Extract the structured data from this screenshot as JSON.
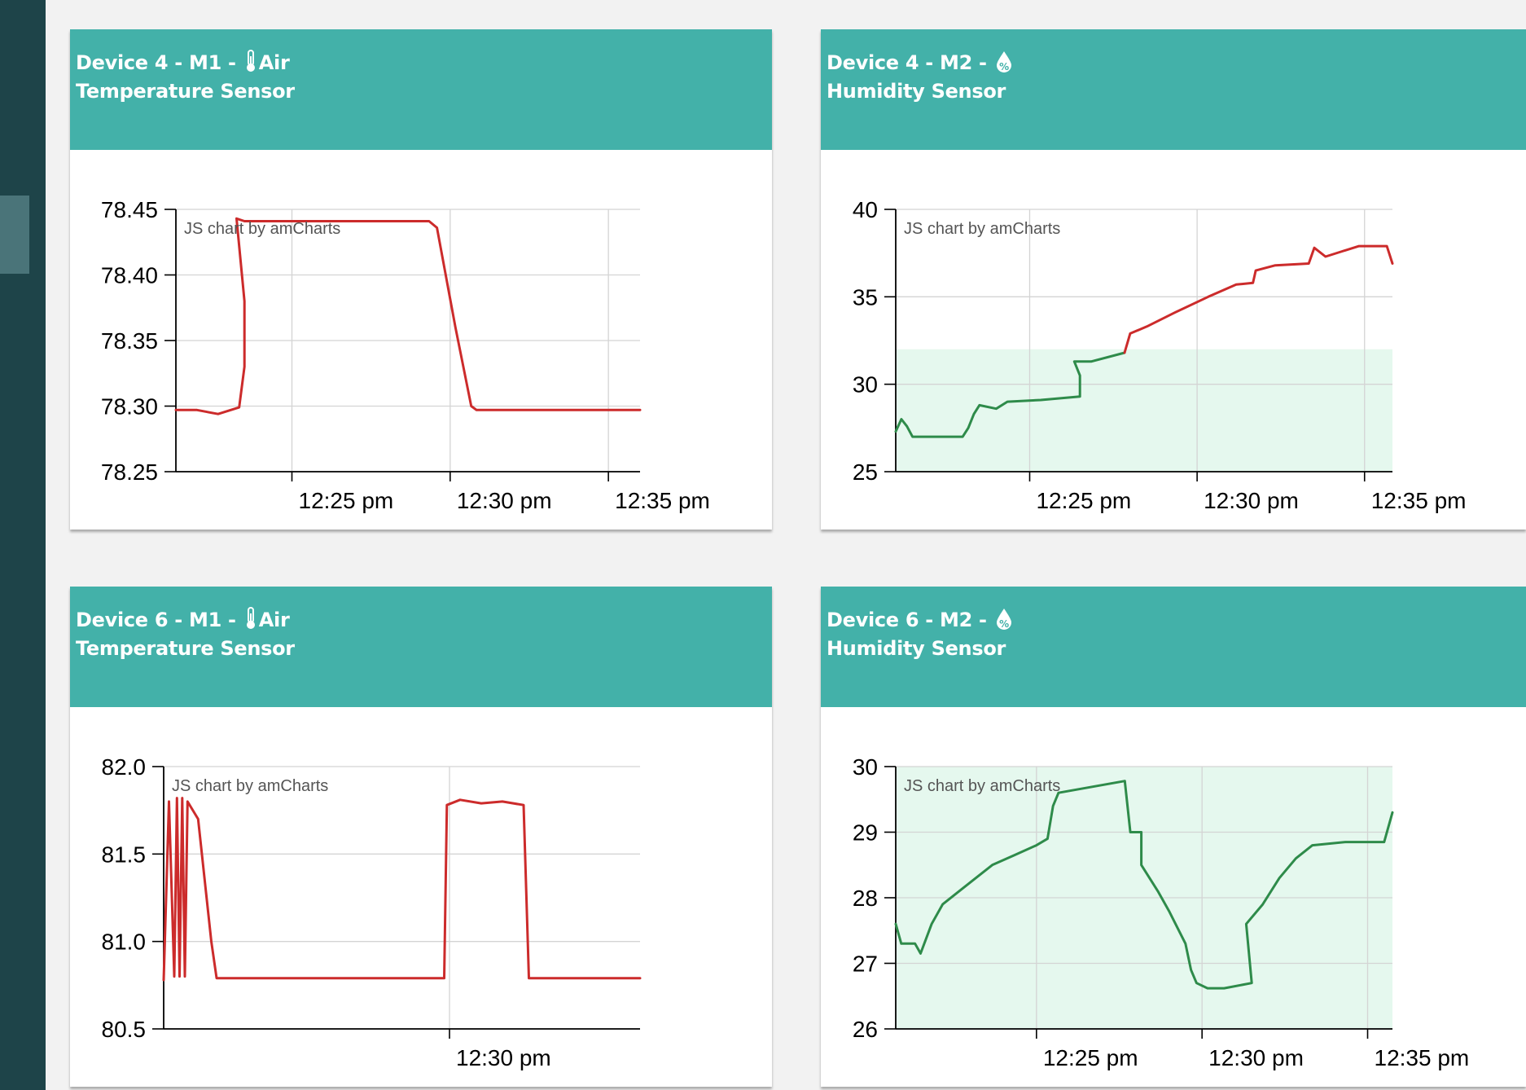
{
  "cards": [
    {
      "title_prefix": "Device 4 - M1 - ",
      "icon": "thermometer-icon",
      "title_suffix": "Air Temperature Sensor",
      "credit": "JS chart by amCharts"
    },
    {
      "title_prefix": "Device 4 - M2 - ",
      "icon": "humidity-drop-icon",
      "title_suffix": "Humidity Sensor",
      "credit": "JS chart by amCharts"
    },
    {
      "title_prefix": "Device 6 - M1 - ",
      "icon": "thermometer-icon",
      "title_suffix": "Air Temperature Sensor",
      "credit": "JS chart by amCharts"
    },
    {
      "title_prefix": "Device 6 - M2 - ",
      "icon": "humidity-drop-icon",
      "title_suffix": "Humidity Sensor",
      "credit": "JS chart by amCharts"
    }
  ],
  "colors": {
    "header": "#43b1a9",
    "sidebar": "#1e4449",
    "line_red": "#cc2b2b",
    "line_green": "#2e8b4a",
    "band_fill": "#e5f8ee"
  },
  "chart_data": [
    {
      "type": "line",
      "xlim": [
        "12:20:40",
        "12:35:20"
      ],
      "ylim": [
        78.25,
        78.45
      ],
      "y_ticks": [
        "78.45",
        "78.40",
        "78.35",
        "78.30",
        "78.25"
      ],
      "x_ticks": [
        {
          "t": "12:24:20",
          "label": "12:25 pm"
        },
        {
          "t": "12:29:20",
          "label": "12:30 pm"
        },
        {
          "t": "12:34:20",
          "label": "12:35 pm"
        }
      ],
      "series": [
        {
          "color": "#cc2b2b",
          "points": [
            [
              "12:20:40",
              78.297
            ],
            [
              "12:21:20",
              78.297
            ],
            [
              "12:22:00",
              78.294
            ],
            [
              "12:22:40",
              78.299
            ],
            [
              "12:22:50",
              78.33
            ],
            [
              "12:22:50",
              78.38
            ],
            [
              "12:22:35",
              78.443
            ],
            [
              "12:22:50",
              78.441
            ],
            [
              "12:28:40",
              78.441
            ],
            [
              "12:28:55",
              78.436
            ],
            [
              "12:29:30",
              78.36
            ],
            [
              "12:30:00",
              78.3
            ],
            [
              "12:30:10",
              78.297
            ],
            [
              "12:35:20",
              78.297
            ]
          ]
        }
      ]
    },
    {
      "type": "line",
      "xlim": [
        "12:20:40",
        "12:35:30"
      ],
      "ylim": [
        25,
        40
      ],
      "y_ticks": [
        "40",
        "35",
        "30",
        "25"
      ],
      "x_ticks": [
        {
          "t": "12:24:40",
          "label": "12:25 pm"
        },
        {
          "t": "12:29:40",
          "label": "12:30 pm"
        },
        {
          "t": "12:34:40",
          "label": "12:35 pm"
        }
      ],
      "band": {
        "from": 25,
        "to": 32
      },
      "series": [
        {
          "color": "#2e8b4a",
          "points": [
            [
              "12:20:40",
              27.3
            ],
            [
              "12:20:50",
              28.0
            ],
            [
              "12:21:00",
              27.6
            ],
            [
              "12:21:10",
              27.0
            ],
            [
              "12:22:00",
              27.0
            ],
            [
              "12:22:40",
              27.0
            ],
            [
              "12:22:50",
              27.5
            ],
            [
              "12:23:00",
              28.3
            ],
            [
              "12:23:10",
              28.8
            ],
            [
              "12:23:40",
              28.6
            ],
            [
              "12:24:00",
              29.0
            ],
            [
              "12:25:00",
              29.1
            ],
            [
              "12:26:10",
              29.3
            ],
            [
              "12:26:10",
              30.5
            ],
            [
              "12:26:00",
              31.3
            ],
            [
              "12:26:30",
              31.3
            ],
            [
              "12:27:30",
              31.8
            ]
          ]
        },
        {
          "color": "#cc2b2b",
          "points": [
            [
              "12:27:30",
              31.8
            ],
            [
              "12:27:40",
              32.9
            ],
            [
              "12:28:10",
              33.3
            ],
            [
              "12:29:00",
              34.1
            ],
            [
              "12:30:00",
              35.0
            ],
            [
              "12:30:50",
              35.7
            ],
            [
              "12:31:20",
              35.8
            ],
            [
              "12:31:25",
              36.5
            ],
            [
              "12:32:00",
              36.8
            ],
            [
              "12:33:00",
              36.9
            ],
            [
              "12:33:10",
              37.8
            ],
            [
              "12:33:30",
              37.3
            ],
            [
              "12:34:00",
              37.6
            ],
            [
              "12:34:30",
              37.9
            ],
            [
              "12:35:20",
              37.9
            ],
            [
              "12:35:30",
              36.9
            ]
          ]
        }
      ]
    },
    {
      "type": "line",
      "xlim": [
        "12:20:20",
        "12:35:20"
      ],
      "ylim": [
        80.5,
        82.0
      ],
      "y_ticks": [
        "82.0",
        "81.5",
        "81.0",
        "80.5"
      ],
      "x_ticks": [
        {
          "t": "12:29:20",
          "label": "12:30 pm"
        }
      ],
      "series": [
        {
          "color": "#cc2b2b",
          "points": [
            [
              "12:20:20",
              80.78
            ],
            [
              "12:20:30",
              81.8
            ],
            [
              "12:20:40",
              80.8
            ],
            [
              "12:20:45",
              81.82
            ],
            [
              "12:20:50",
              80.8
            ],
            [
              "12:20:55",
              81.82
            ],
            [
              "12:21:00",
              80.8
            ],
            [
              "12:21:05",
              81.8
            ],
            [
              "12:21:25",
              81.7
            ],
            [
              "12:21:50",
              81.0
            ],
            [
              "12:22:00",
              80.79
            ],
            [
              "12:29:10",
              80.79
            ],
            [
              "12:29:15",
              81.78
            ],
            [
              "12:29:40",
              81.81
            ],
            [
              "12:30:20",
              81.79
            ],
            [
              "12:31:00",
              81.8
            ],
            [
              "12:31:40",
              81.78
            ],
            [
              "12:31:50",
              80.79
            ],
            [
              "12:35:20",
              80.79
            ]
          ]
        }
      ]
    },
    {
      "type": "line",
      "xlim": [
        "12:20:45",
        "12:35:45"
      ],
      "ylim": [
        26,
        30
      ],
      "y_ticks": [
        "30",
        "29",
        "28",
        "27",
        "26"
      ],
      "x_ticks": [
        {
          "t": "12:25:00",
          "label": "12:25 pm"
        },
        {
          "t": "12:30:00",
          "label": "12:30 pm"
        },
        {
          "t": "12:35:00",
          "label": "12:35 pm"
        }
      ],
      "band": {
        "from": 26,
        "to": 30
      },
      "series": [
        {
          "color": "#2e8b4a",
          "points": [
            [
              "12:20:45",
              27.6
            ],
            [
              "12:20:55",
              27.3
            ],
            [
              "12:21:20",
              27.3
            ],
            [
              "12:21:30",
              27.15
            ],
            [
              "12:21:50",
              27.6
            ],
            [
              "12:22:10",
              27.9
            ],
            [
              "12:22:40",
              28.1
            ],
            [
              "12:23:10",
              28.3
            ],
            [
              "12:23:40",
              28.5
            ],
            [
              "12:24:20",
              28.65
            ],
            [
              "12:25:00",
              28.8
            ],
            [
              "12:25:20",
              28.9
            ],
            [
              "12:25:30",
              29.4
            ],
            [
              "12:25:40",
              29.6
            ],
            [
              "12:27:40",
              29.78
            ],
            [
              "12:27:50",
              29.0
            ],
            [
              "12:28:10",
              29.0
            ],
            [
              "12:28:10",
              28.5
            ],
            [
              "12:28:40",
              28.1
            ],
            [
              "12:29:00",
              27.8
            ],
            [
              "12:29:30",
              27.3
            ],
            [
              "12:29:40",
              26.9
            ],
            [
              "12:29:50",
              26.7
            ],
            [
              "12:30:10",
              26.62
            ],
            [
              "12:30:40",
              26.62
            ],
            [
              "12:31:30",
              26.7
            ],
            [
              "12:31:20",
              27.6
            ],
            [
              "12:31:50",
              27.9
            ],
            [
              "12:32:20",
              28.3
            ],
            [
              "12:32:50",
              28.6
            ],
            [
              "12:33:20",
              28.8
            ],
            [
              "12:34:20",
              28.85
            ],
            [
              "12:35:30",
              28.85
            ],
            [
              "12:35:45",
              29.3
            ]
          ]
        }
      ]
    }
  ]
}
